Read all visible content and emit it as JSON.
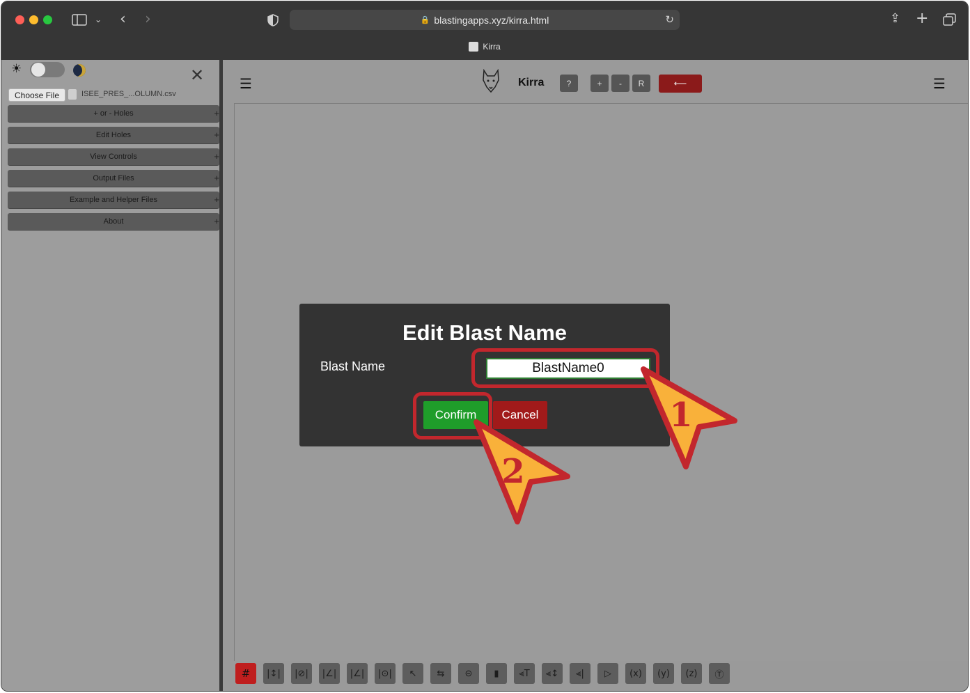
{
  "browser": {
    "url": "blastingapps.xyz/kirra.html",
    "tab_title": "Kirra",
    "icons": [
      "sidebar-icon",
      "chevron-down-icon",
      "back-icon",
      "forward-icon",
      "shield-icon",
      "lock-icon",
      "reload-icon",
      "share-icon",
      "new-tab-icon",
      "tabs-overview-icon"
    ]
  },
  "sidebar": {
    "choose_file_label": "Choose File",
    "file_name": "ISEE_PRES_...OLUMN.csv",
    "items": [
      {
        "label": "+ or - Holes"
      },
      {
        "label": "Edit Holes"
      },
      {
        "label": "View Controls"
      },
      {
        "label": "Output Files"
      },
      {
        "label": "Example and Helper Files"
      },
      {
        "label": "About"
      }
    ],
    "item_expand_glyph": "+"
  },
  "toolbar": {
    "app_name": "Kirra",
    "help_label": "?",
    "zoom_in_label": "+",
    "zoom_out_label": "-",
    "reset_label": "R",
    "back_label": "⟵"
  },
  "bottom_tools": [
    "#",
    "|↕|",
    "|⊘|",
    "|∠|",
    "|∠|",
    "|⊙|",
    "↖",
    "⇆",
    "⊝",
    "▮",
    "⫷T",
    "⫷↕",
    "⫷|",
    "▷",
    "(x)",
    "(y)",
    "(z)",
    "Ⓣ"
  ],
  "dialog": {
    "title": "Edit Blast Name",
    "field_label": "Blast Name",
    "field_value": "BlastName0",
    "confirm_label": "Confirm",
    "cancel_label": "Cancel"
  },
  "annotations": [
    {
      "number": "1",
      "target": "blast-name-input"
    },
    {
      "number": "2",
      "target": "confirm-button"
    }
  ],
  "colors": {
    "highlight": "#c2272d",
    "pointer": "#f9b13a",
    "confirm": "#1f9d2a",
    "cancel": "#a11a1a"
  }
}
